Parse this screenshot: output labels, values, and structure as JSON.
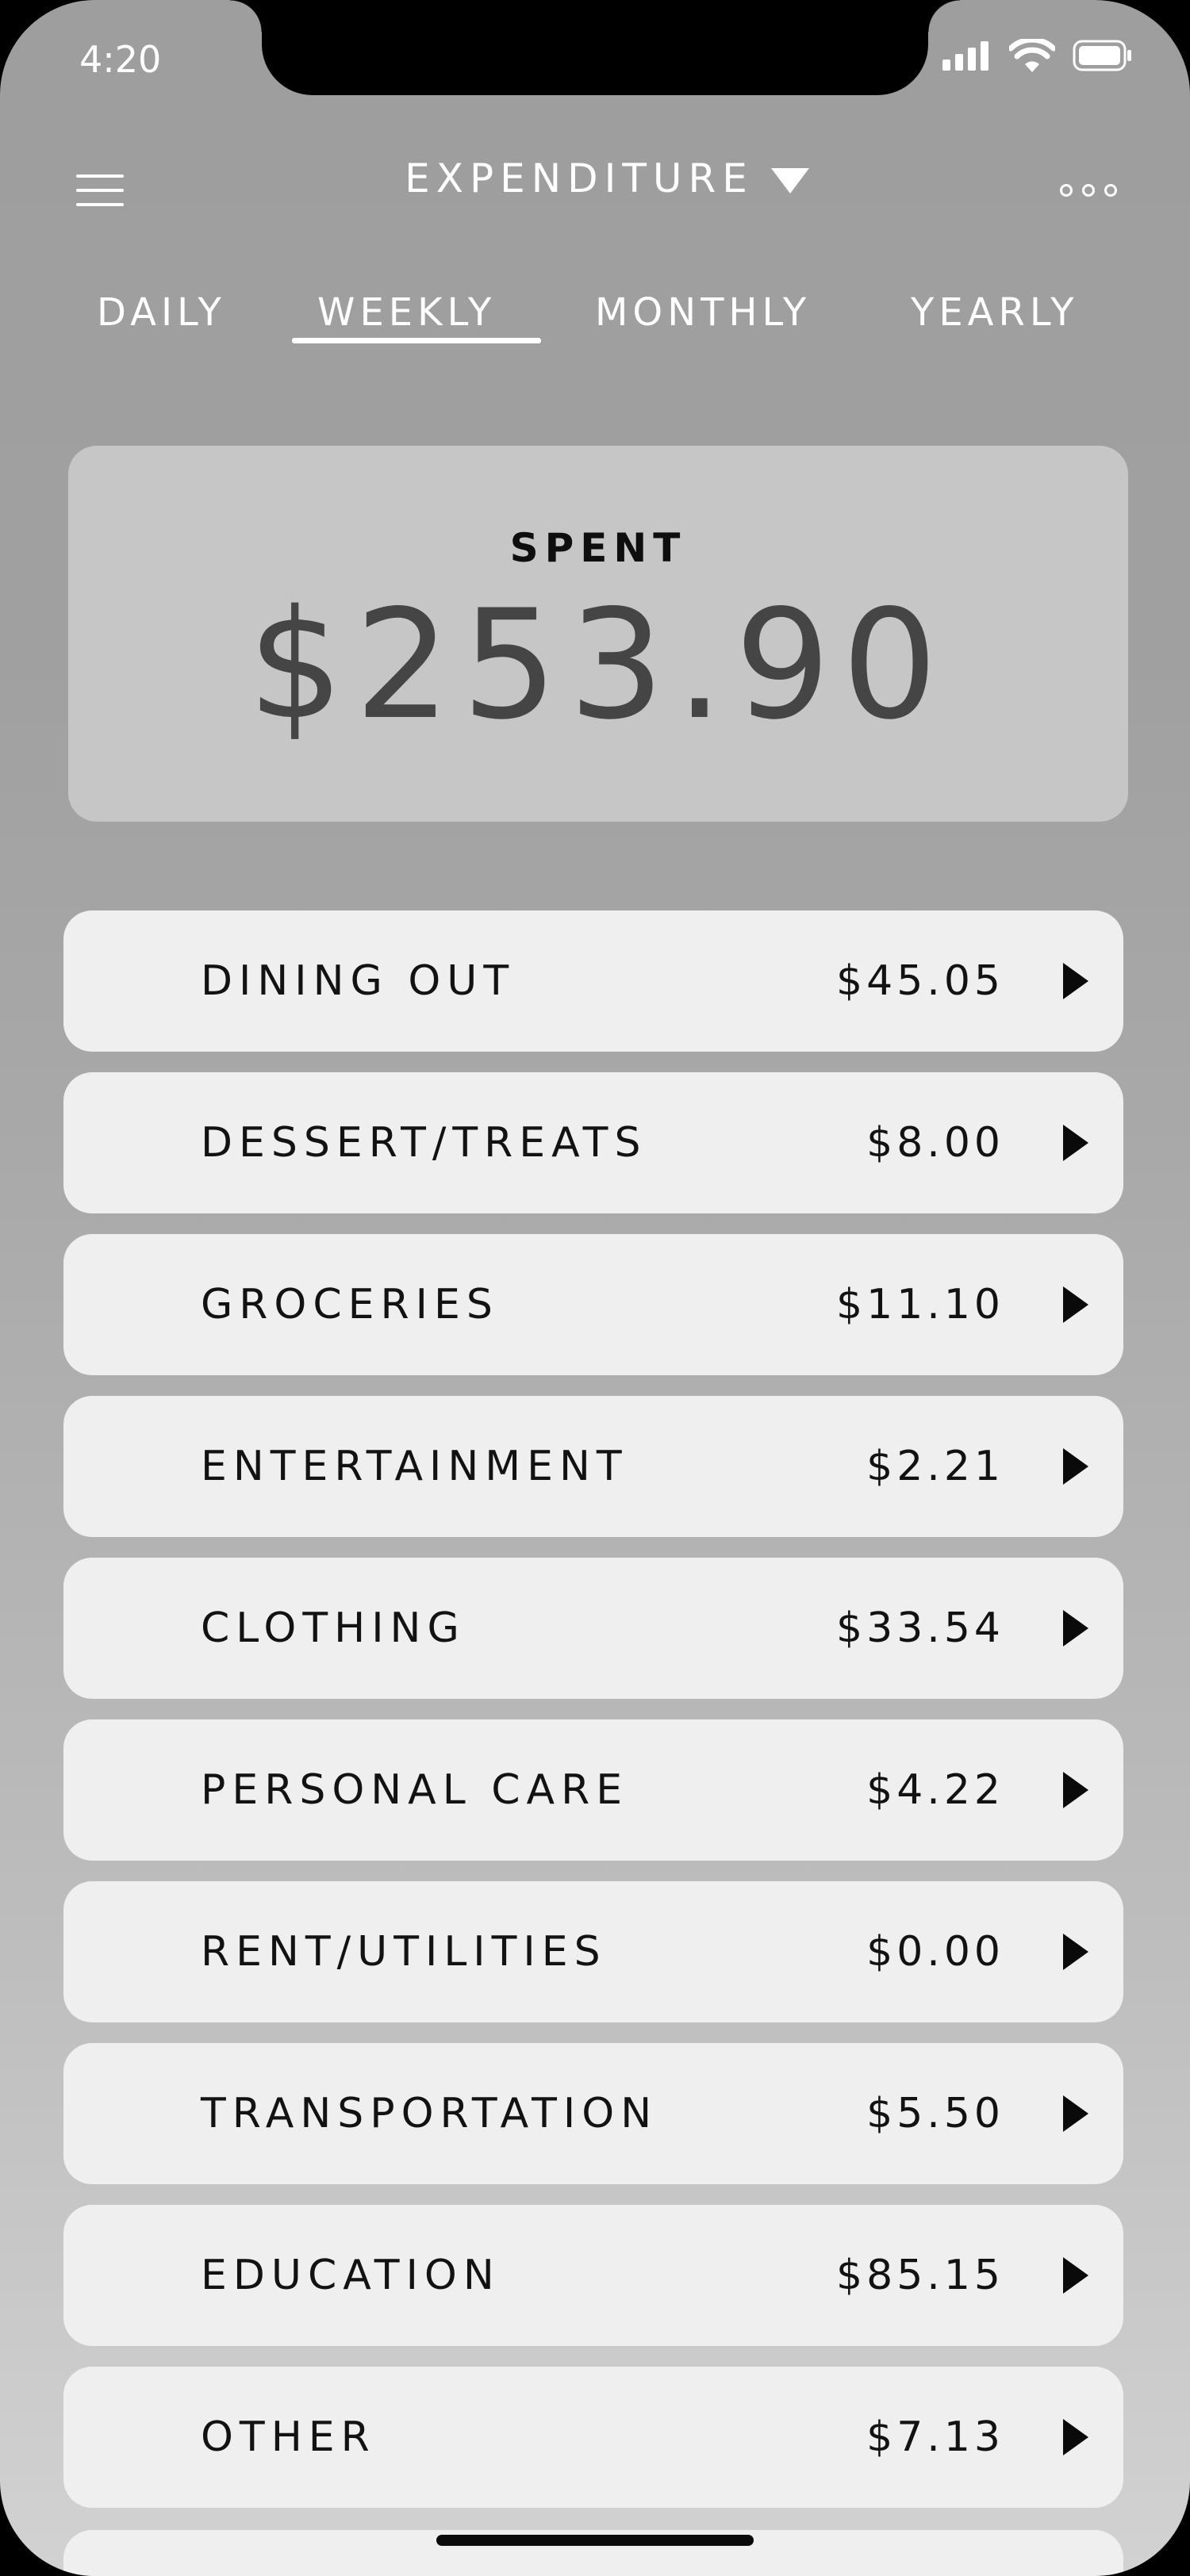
{
  "status_bar": {
    "time": "4:20",
    "icons": [
      "cellular-signal-icon",
      "wifi-icon",
      "battery-icon"
    ]
  },
  "header": {
    "title": "EXPENDITURE",
    "menu_icon": "hamburger-menu-icon",
    "dropdown_icon": "triangle-down-icon",
    "more_icon": "more-options-icon"
  },
  "tabs": [
    {
      "label": "DAILY",
      "active": false
    },
    {
      "label": "WEEKLY",
      "active": true
    },
    {
      "label": "MONTHLY",
      "active": false
    },
    {
      "label": "YEARLY",
      "active": false
    }
  ],
  "summary": {
    "label": "SPENT",
    "amount": "$253.90"
  },
  "categories": [
    {
      "name": "DINING OUT",
      "amount": "$45.05"
    },
    {
      "name": "DESSERT/TREATS",
      "amount": "$8.00"
    },
    {
      "name": "GROCERIES",
      "amount": "$11.10"
    },
    {
      "name": "ENTERTAINMENT",
      "amount": "$2.21"
    },
    {
      "name": "CLOTHING",
      "amount": "$33.54"
    },
    {
      "name": "PERSONAL CARE",
      "amount": "$4.22"
    },
    {
      "name": "RENT/UTILITIES",
      "amount": "$0.00"
    },
    {
      "name": "TRANSPORTATION",
      "amount": "$5.50"
    },
    {
      "name": "EDUCATION",
      "amount": "$85.15"
    },
    {
      "name": "OTHER",
      "amount": "$7.13"
    }
  ],
  "colors": {
    "background_top": "#9e9e9e",
    "background_bottom": "#d2d2d2",
    "card": "#f0eff0",
    "summary_card": "#c6c6c6",
    "text_dark": "#121212",
    "text_light": "#ffffff"
  }
}
